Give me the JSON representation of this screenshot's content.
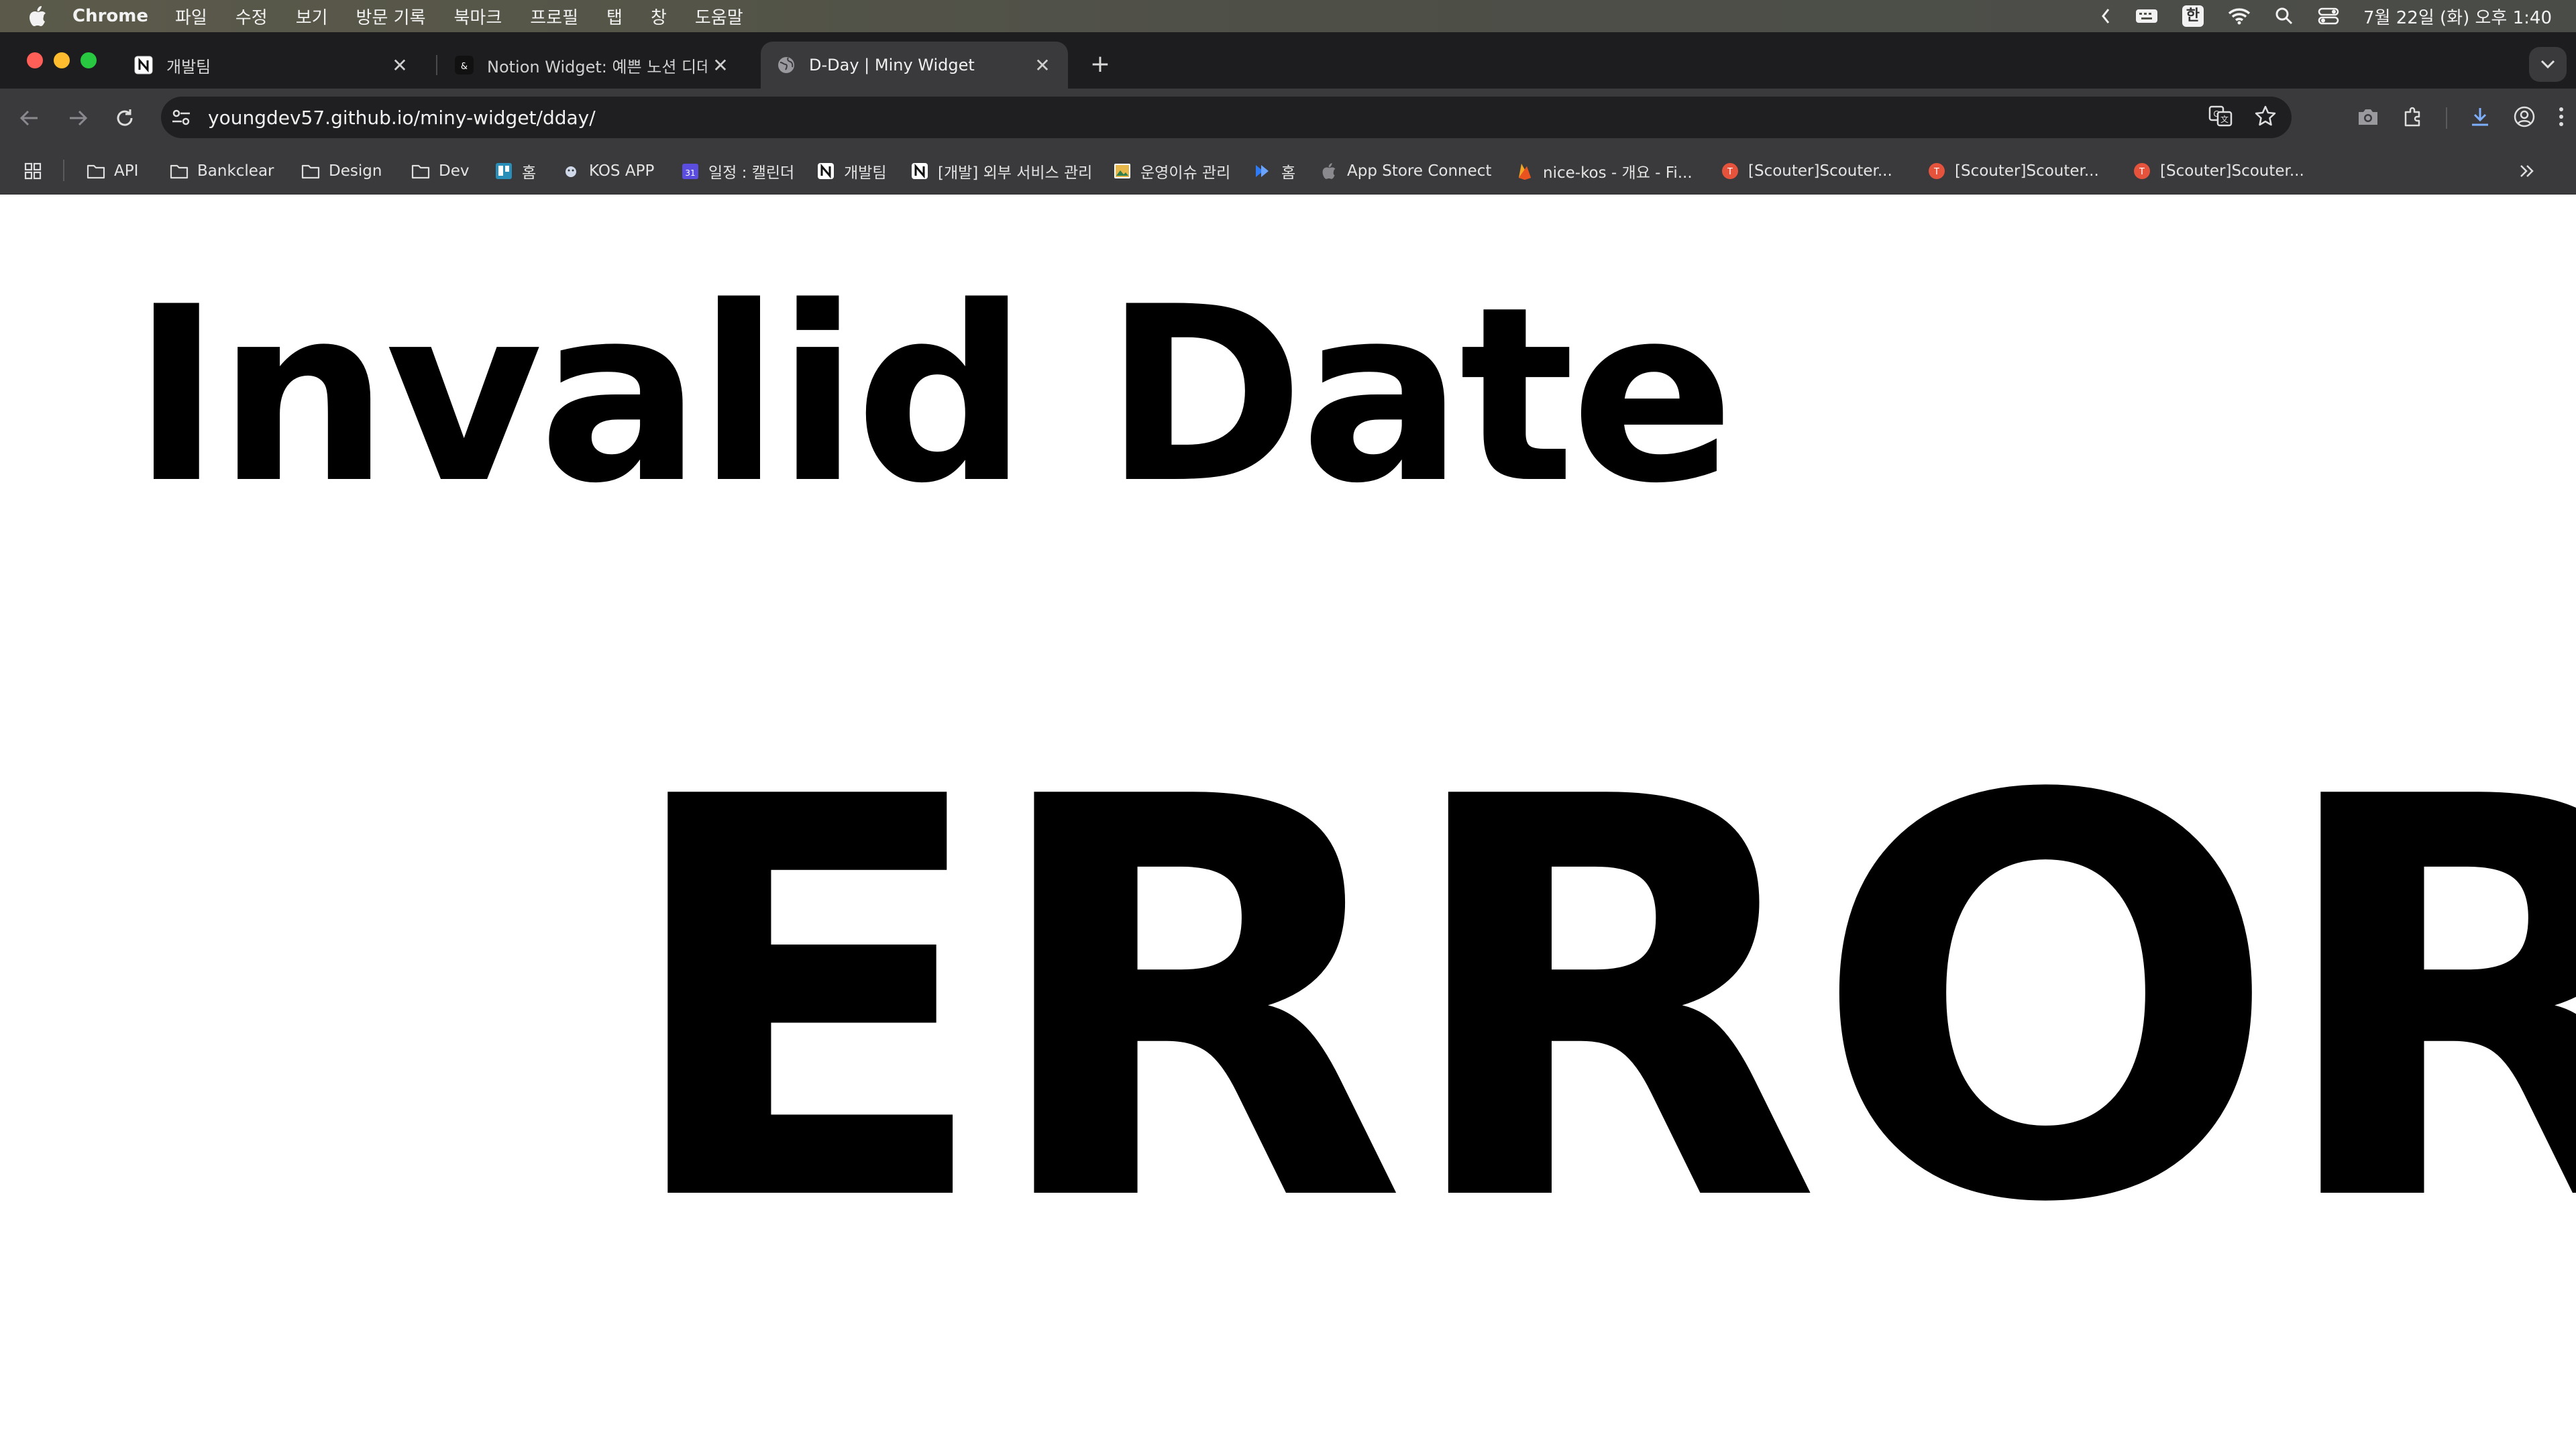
{
  "menubar": {
    "app_name": "Chrome",
    "menus": [
      "파일",
      "수정",
      "보기",
      "방문 기록",
      "북마크",
      "프로필",
      "탭",
      "창",
      "도움말"
    ],
    "input_method": "한",
    "datetime": "7월 22일 (화) 오후 1:40"
  },
  "tabs": [
    {
      "title": "개발팀",
      "icon": "notion-icon",
      "active": false
    },
    {
      "title": "Notion Widget: 예쁜 노션 디데이",
      "icon": "notion-widget-icon",
      "active": false
    },
    {
      "title": "D-Day | Miny Widget",
      "icon": "globe-icon",
      "active": true
    }
  ],
  "toolbar": {
    "url": "youngdev57.github.io/miny-widget/dday/"
  },
  "bookmarks": [
    {
      "label": "API",
      "icon": "folder-icon"
    },
    {
      "label": "Bankclear",
      "icon": "folder-icon"
    },
    {
      "label": "Design",
      "icon": "folder-icon"
    },
    {
      "label": "Dev",
      "icon": "folder-icon"
    },
    {
      "label": "홈",
      "icon": "trello-icon"
    },
    {
      "label": "KOS APP",
      "icon": "app-icon"
    },
    {
      "label": "일정 : 캘린더",
      "icon": "calendar-icon"
    },
    {
      "label": "개발팀",
      "icon": "notion-icon"
    },
    {
      "label": "[개발] 외부 서비스 관리",
      "icon": "notion-icon"
    },
    {
      "label": "운영이슈 관리",
      "icon": "image-icon"
    },
    {
      "label": "홈",
      "icon": "jira-icon"
    },
    {
      "label": "App Store Connect",
      "icon": "apple-icon"
    },
    {
      "label": "nice-kos - 개요 - Fi...",
      "icon": "firebase-icon"
    },
    {
      "label": "[Scouter]Scouter...",
      "icon": "scouter-icon"
    },
    {
      "label": "[Scouter]Scouter...",
      "icon": "scouter-icon"
    },
    {
      "label": "[Scouter]Scouter...",
      "icon": "scouter-icon"
    }
  ],
  "content": {
    "date": "Invalid Date",
    "dday": "ERROR"
  }
}
